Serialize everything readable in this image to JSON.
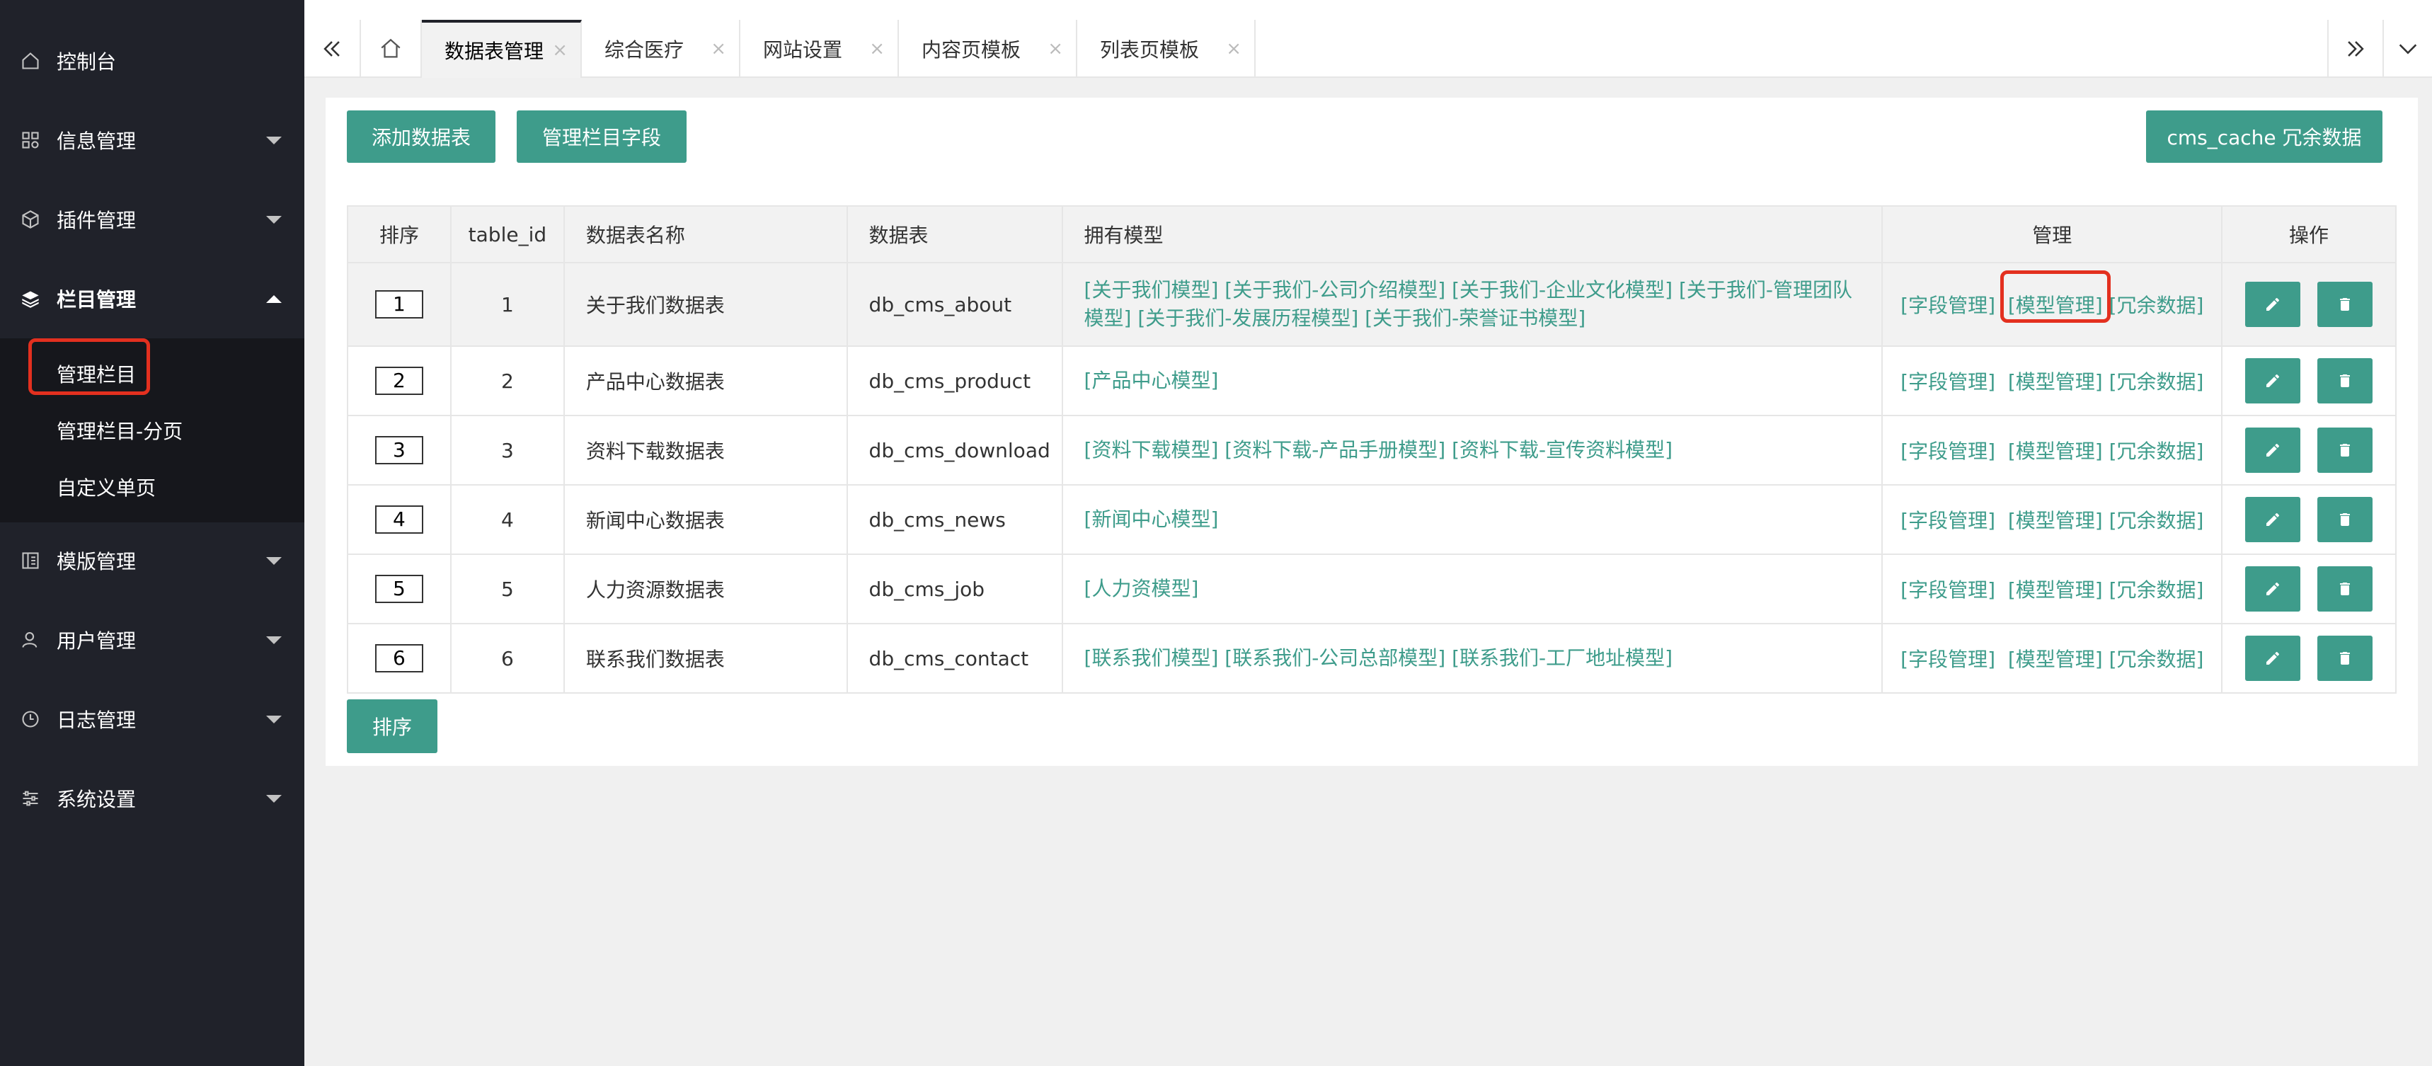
{
  "sidebar": {
    "items": [
      {
        "label": "控制台",
        "icon": "home-icon"
      },
      {
        "label": "信息管理",
        "icon": "grid-icon"
      },
      {
        "label": "插件管理",
        "icon": "cube-icon"
      },
      {
        "label": "栏目管理",
        "icon": "layers-icon"
      },
      {
        "label": "模版管理",
        "icon": "template-icon"
      },
      {
        "label": "用户管理",
        "icon": "user-icon"
      },
      {
        "label": "日志管理",
        "icon": "clock-icon"
      },
      {
        "label": "系统设置",
        "icon": "sliders-icon"
      }
    ],
    "submenu": [
      "管理栏目",
      "管理栏目-分页",
      "自定义单页"
    ]
  },
  "tabs": {
    "items": [
      {
        "label": "数据表管理",
        "close": "×"
      },
      {
        "label": "综合医疗",
        "close": "×"
      },
      {
        "label": "网站设置",
        "close": "×"
      },
      {
        "label": "内容页模板",
        "close": "×"
      },
      {
        "label": "列表页模板",
        "close": "×"
      }
    ]
  },
  "toolbar": {
    "add_table": "添加数据表",
    "manage_fields": "管理栏目字段",
    "cache": "cms_cache 冗余数据",
    "sort": "排序"
  },
  "table": {
    "headers": [
      "排序",
      "table_id",
      "数据表名称",
      "数据表",
      "拥有模型",
      "管理",
      "操作"
    ],
    "manage_links": [
      "[字段管理]",
      "[模型管理]",
      "[冗余数据]"
    ],
    "rows": [
      {
        "order": "1",
        "id": "1",
        "name": "关于我们数据表",
        "db": "db_cms_about",
        "models": "[关于我们模型]  [关于我们-公司介绍模型]  [关于我们-企业文化模型]  [关于我们-管理团队模型]  [关于我们-发展历程模型]  [关于我们-荣誉证书模型]"
      },
      {
        "order": "2",
        "id": "2",
        "name": "产品中心数据表",
        "db": "db_cms_product",
        "models": "[产品中心模型]"
      },
      {
        "order": "3",
        "id": "3",
        "name": "资料下载数据表",
        "db": "db_cms_download",
        "models": "[资料下载模型]  [资料下载-产品手册模型]  [资料下载-宣传资料模型]"
      },
      {
        "order": "4",
        "id": "4",
        "name": "新闻中心数据表",
        "db": "db_cms_news",
        "models": "[新闻中心模型]"
      },
      {
        "order": "5",
        "id": "5",
        "name": "人力资源数据表",
        "db": "db_cms_job",
        "models": "[人力资模型]"
      },
      {
        "order": "6",
        "id": "6",
        "name": "联系我们数据表",
        "db": "db_cms_contact",
        "models": "[联系我们模型]  [联系我们-公司总部模型]  [联系我们-工厂地址模型]"
      }
    ]
  },
  "colors": {
    "accent": "#3e9c8b",
    "sidebar": "#20222a",
    "highlight": "#e3301f"
  }
}
